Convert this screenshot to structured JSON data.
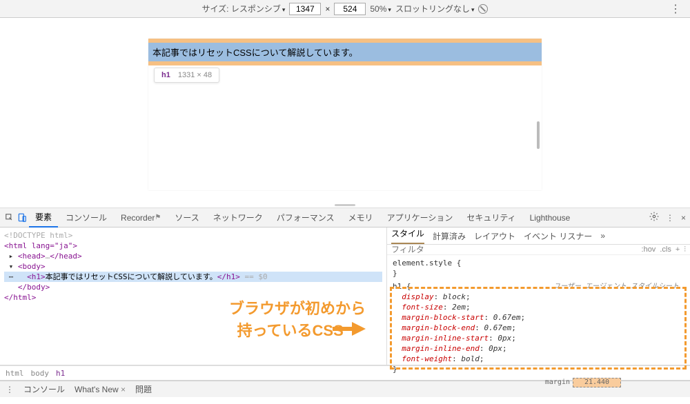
{
  "deviceToolbar": {
    "sizeLabel": "サイズ: レスポンシブ",
    "width": "1347",
    "x": "×",
    "height": "524",
    "zoom": "50%",
    "throttling": "スロットリングなし"
  },
  "page": {
    "h1": "本記事ではリセットCSSについて解説しています。",
    "tooltipTag": "h1",
    "tooltipDims": "1331 × 48"
  },
  "devtoolsTabs": {
    "elements": "要素",
    "console": "コンソール",
    "recorder": "Recorder",
    "sources": "ソース",
    "network": "ネットワーク",
    "performance": "パフォーマンス",
    "memory": "メモリ",
    "application": "アプリケーション",
    "security": "セキュリティ",
    "lighthouse": "Lighthouse"
  },
  "dom": {
    "doctype": "<!DOCTYPE html>",
    "htmlOpen": "<html lang=\"ja\">",
    "headOpen": "<head>",
    "headEllipsis": "…",
    "headClose": "</head>",
    "bodyOpen": "<body>",
    "h1Open": "<h1>",
    "h1Text": "本記事ではリセットCSSについて解説しています。",
    "h1Close": "</h1>",
    "eqDollar": " == $0",
    "bodyClose": "</body>",
    "htmlClose": "</html>"
  },
  "stylesTabs": {
    "styles": "スタイル",
    "computed": "計算済み",
    "layout": "レイアウト",
    "listeners": "イベント リスナー",
    "more": "»"
  },
  "stylesFilter": {
    "placeholder": "フィルタ",
    "hov": ":hov",
    "cls": ".cls",
    "plus": "+"
  },
  "rules": {
    "elementStyle": "element.style {",
    "close1": "}",
    "h1open": "h1 {",
    "uaLabel": "ユーザー エージェント スタイルシート",
    "p1": "display",
    "v1": "block",
    "p2": "font-size",
    "v2": "2em",
    "p3": "margin-block-start",
    "v3": "0.67em",
    "p4": "margin-block-end",
    "v4": "0.67em",
    "p5": "margin-inline-start",
    "v5": "0px",
    "p6": "margin-inline-end",
    "v6": "0px",
    "p7": "font-weight",
    "v7": "bold",
    "close2": "}"
  },
  "annotation": {
    "line1": "ブラウザが初めから",
    "line2": "持っているCSS"
  },
  "breadcrumb": {
    "html": "html",
    "body": "body",
    "h1": "h1"
  },
  "boxModel": {
    "label": "margin",
    "val": "21.440"
  },
  "drawer": {
    "console": "コンソール",
    "whatsnew": "What's New",
    "issues": "問題"
  }
}
